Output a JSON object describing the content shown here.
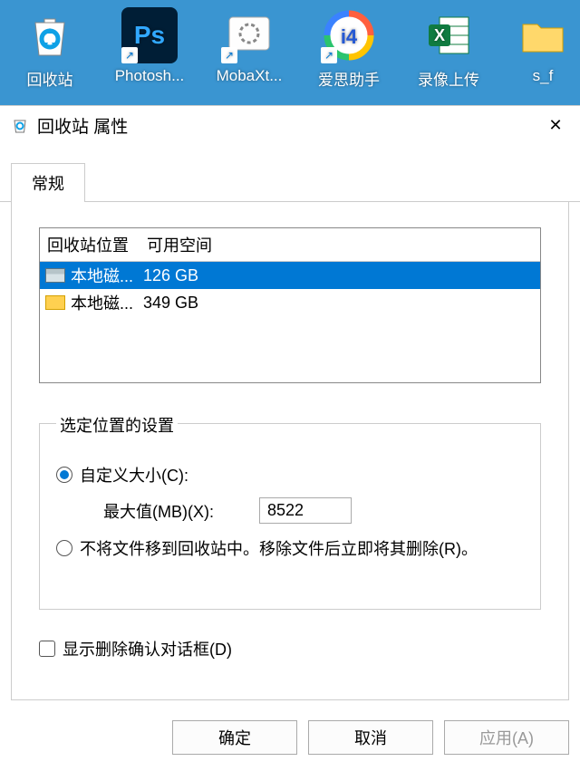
{
  "desktop": {
    "icons": [
      {
        "name": "recycle-bin",
        "label": "回收站",
        "color": "#ffffff"
      },
      {
        "name": "photoshop",
        "label": "Photosh...",
        "bg": "#001e36",
        "txt": "Ps",
        "txtColor": "#31a8ff",
        "shortcut": true
      },
      {
        "name": "mobaxterm",
        "label": "MobaXt...",
        "color": "#ffffff",
        "shortcut": true
      },
      {
        "name": "aisi",
        "label": "爱思助手",
        "shortcut": true
      },
      {
        "name": "excel",
        "label": "录像上传",
        "bg": "#107c41",
        "txt": "X",
        "txtColor": "#ffffff"
      },
      {
        "name": "folder-sf",
        "label": "s_f",
        "color": "#ffd050"
      }
    ]
  },
  "dialog": {
    "title": "回收站 属性",
    "tabs": {
      "general": "常规"
    },
    "table": {
      "headers": {
        "location": "回收站位置",
        "space": "可用空间"
      },
      "rows": [
        {
          "name": "本地磁...",
          "space": "126 GB",
          "selected": true,
          "iconColor": "gray"
        },
        {
          "name": "本地磁...",
          "space": "349 GB",
          "selected": false,
          "iconColor": "yellow"
        }
      ]
    },
    "fieldset": {
      "legend": "选定位置的设置",
      "custom_label": "自定义大小(C):",
      "max_label": "最大值(MB)(X):",
      "max_value": "8522",
      "dont_move_label": "不将文件移到回收站中。移除文件后立即将其删除(R)。",
      "selected": "custom"
    },
    "confirm_checkbox": {
      "label": "显示删除确认对话框(D)",
      "checked": false
    },
    "buttons": {
      "ok": "确定",
      "cancel": "取消",
      "apply": "应用(A)"
    }
  }
}
